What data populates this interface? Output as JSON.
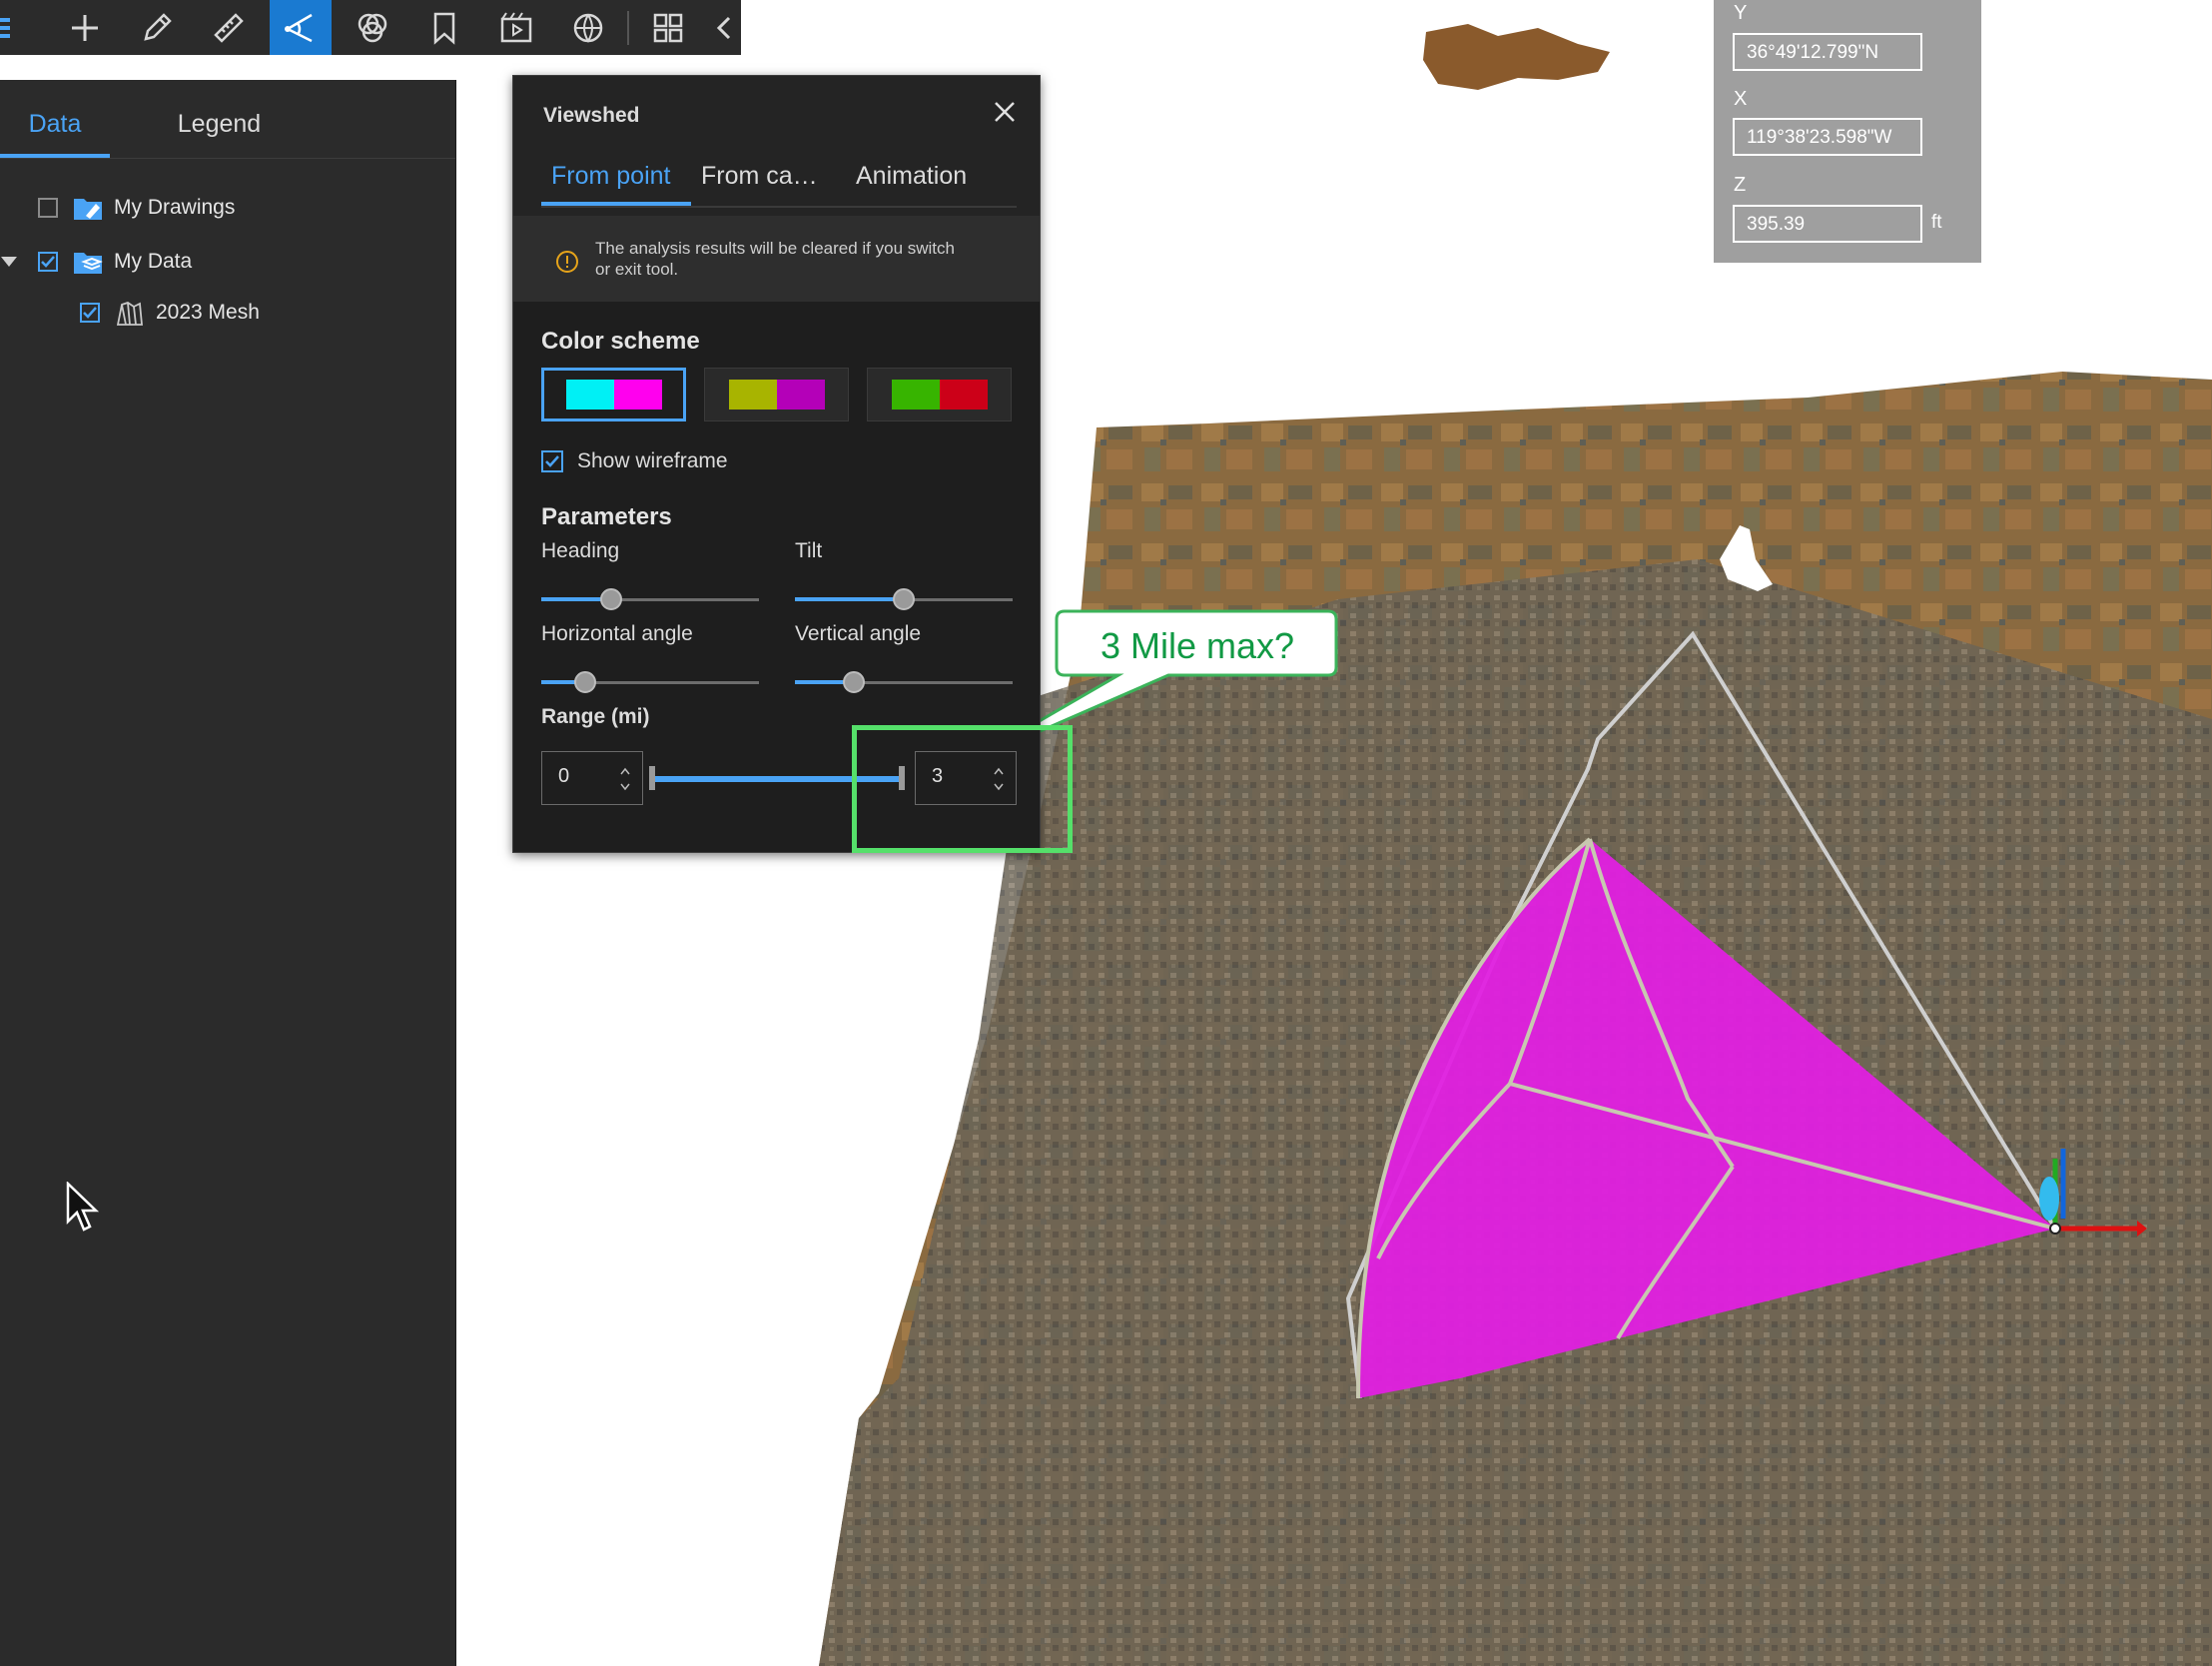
{
  "toolbar": {
    "buttons": [
      {
        "icon": "menu-icon"
      },
      {
        "icon": "plus-icon"
      },
      {
        "icon": "pencil-icon"
      },
      {
        "icon": "ruler-icon"
      },
      {
        "icon": "viewshed-icon",
        "active": true
      },
      {
        "icon": "overlap-circles-icon"
      },
      {
        "icon": "bookmark-icon"
      },
      {
        "icon": "clapperboard-icon"
      },
      {
        "icon": "globe-icon"
      },
      {
        "icon": "grid-icon"
      },
      {
        "icon": "chevron-left-icon"
      }
    ]
  },
  "data_panel": {
    "tabs": [
      {
        "label": "Data",
        "active": true
      },
      {
        "label": "Legend",
        "active": false
      }
    ],
    "tree": [
      {
        "label": "My Drawings",
        "checked": false,
        "icon": "drawings-folder-icon"
      },
      {
        "label": "My Data",
        "checked": true,
        "expanded": true,
        "icon": "data-folder-icon"
      },
      {
        "label": "2023 Mesh",
        "checked": true,
        "icon": "mesh-layer-icon"
      }
    ]
  },
  "viewshed": {
    "title": "Viewshed",
    "tabs": [
      {
        "label": "From point",
        "active": true
      },
      {
        "label": "From ca…",
        "active": false
      },
      {
        "label": "Animation",
        "active": false
      }
    ],
    "notice": "The analysis results will be cleared if you switch or exit tool.",
    "color_scheme_heading": "Color scheme",
    "color_schemes": [
      {
        "visible": "#00f0f5",
        "hidden": "#ff00ee",
        "selected": true
      },
      {
        "visible": "#a8b400",
        "hidden": "#b400b8",
        "selected": false
      },
      {
        "visible": "#37b400",
        "hidden": "#cc0018",
        "selected": false
      }
    ],
    "show_wireframe_label": "Show wireframe",
    "show_wireframe": true,
    "parameters_heading": "Parameters",
    "heading_label": "Heading",
    "heading_value": 0.32,
    "tilt_label": "Tilt",
    "tilt_value": 0.5,
    "horizontal_angle_label": "Horizontal angle",
    "horizontal_angle_value": 0.2,
    "vertical_angle_label": "Vertical angle",
    "vertical_angle_value": 0.27,
    "range_label": "Range (mi)",
    "range_min": "0",
    "range_max": "3"
  },
  "coordinates": {
    "y_label": "Y",
    "y_value": "36°49'12.799\"N",
    "x_label": "X",
    "x_value": "119°38'23.598\"W",
    "z_label": "Z",
    "z_value": "395.39",
    "z_unit": "ft"
  },
  "callout": {
    "text": "3 Mile max?",
    "color": "#119944",
    "highlight_color": "#55e06a"
  },
  "colors": {
    "accent": "#4aa3f5",
    "viewshed_hidden": "#e020e0",
    "panel_bg": "#2b2b2b"
  }
}
